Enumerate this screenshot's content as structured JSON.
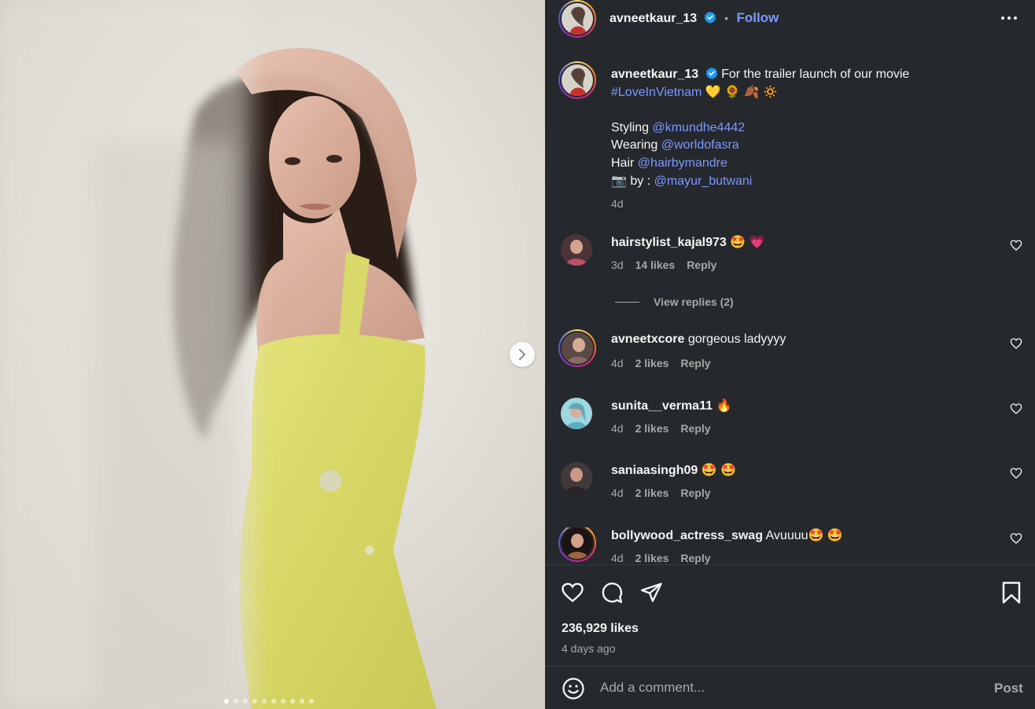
{
  "post": {
    "author": "avneetkaur_13",
    "follow_label": "Follow",
    "separator": "•",
    "more_icon": "more-horizontal-icon",
    "image_count": 10,
    "active_image_index": 0
  },
  "caption": {
    "username": "avneetkaur_13",
    "line1": "For the trailer launch of our movie",
    "hashtag": "#LoveInVietnam",
    "emojis": "💛 🌻 🍂 🔅",
    "credits": [
      {
        "label": "Styling",
        "handle": "@kmundhe4442"
      },
      {
        "label": "Wearing",
        "handle": "@worldofasra"
      },
      {
        "label": "Hair",
        "handle": "@hairbymandre"
      },
      {
        "label": "📷 by :",
        "handle": "@mayur_butwani"
      }
    ],
    "time": "4d"
  },
  "comments": [
    {
      "username": "hairstylist_kajal973",
      "text": "🤩 💗",
      "time": "3d",
      "likes": "14 likes",
      "reply": "Reply"
    },
    {
      "username": "avneetxcore",
      "text": "gorgeous ladyyyy",
      "time": "4d",
      "likes": "2 likes",
      "reply": "Reply"
    },
    {
      "username": "sunita__verma11",
      "text": "🔥",
      "time": "4d",
      "likes": "2 likes",
      "reply": "Reply"
    },
    {
      "username": "saniaasingh09",
      "text": "🤩 🤩",
      "time": "4d",
      "likes": "2 likes",
      "reply": "Reply"
    },
    {
      "username": "bollywood_actress_swag",
      "text": "Avuuuu🤩 🤩",
      "time": "4d",
      "likes": "2 likes",
      "reply": "Reply"
    }
  ],
  "view_replies": "View replies (2)",
  "stats": {
    "likes": "236,929 likes",
    "posted": "4 days ago"
  },
  "comment_box": {
    "placeholder": "Add a comment...",
    "post_label": "Post"
  },
  "colors": {
    "background": "#25292e",
    "link": "#7d97ff",
    "verified": "#1d9bf0",
    "muted": "#a8a8a8"
  }
}
